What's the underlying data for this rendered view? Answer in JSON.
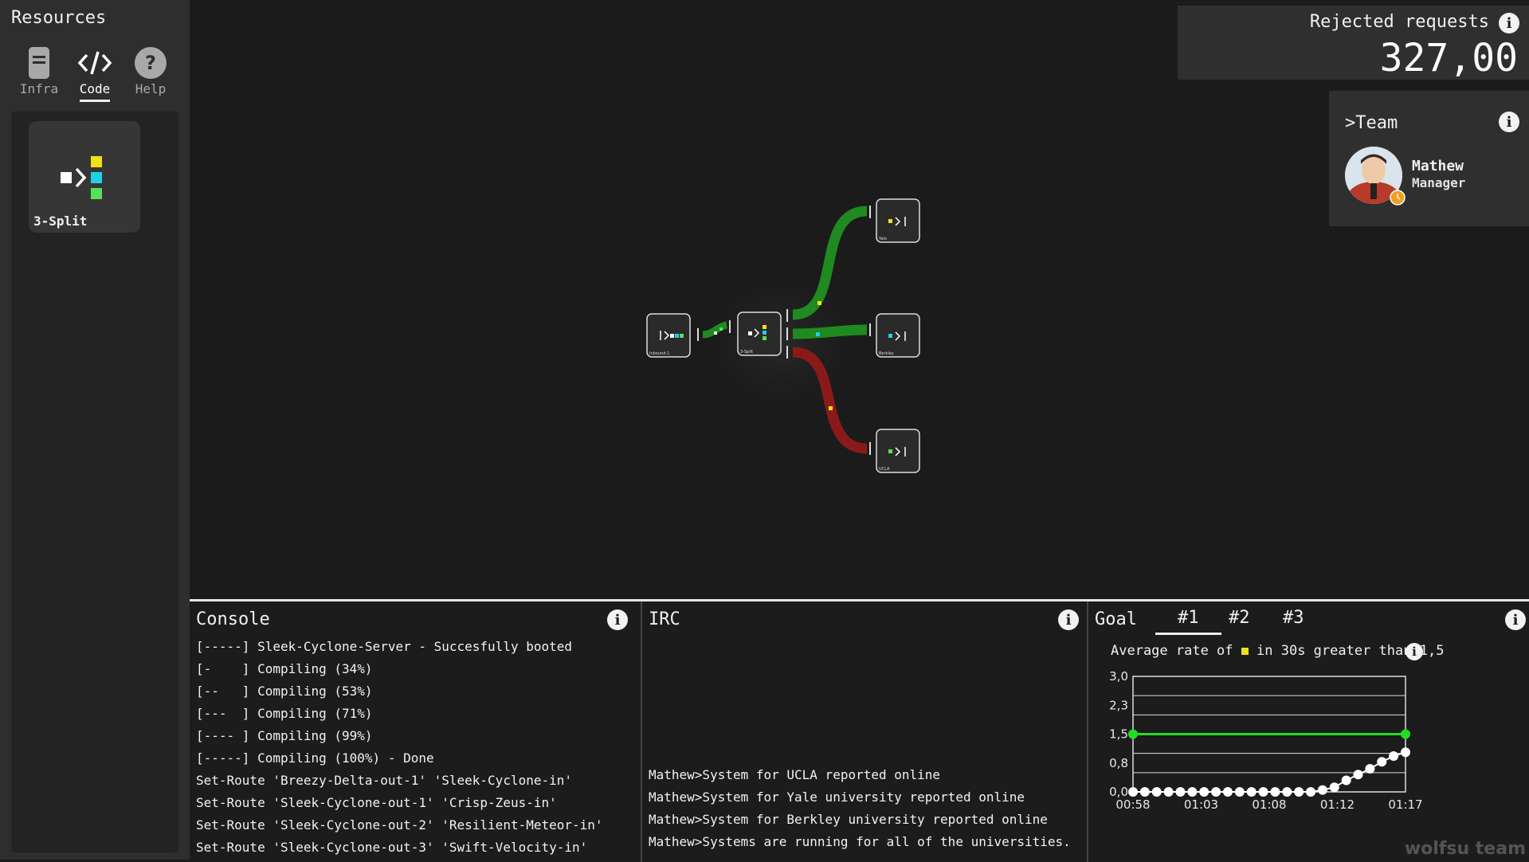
{
  "sidebar": {
    "title": "Resources",
    "tabs": [
      {
        "label": "Infra",
        "icon": "server-icon",
        "active": false
      },
      {
        "label": "Code",
        "icon": "code-icon",
        "active": true
      },
      {
        "label": "Help",
        "icon": "help-icon",
        "active": false
      }
    ],
    "resource_card": {
      "label": "3-Split",
      "icon": "split-icon"
    }
  },
  "rejected": {
    "label": "Rejected requests",
    "value": "327,00"
  },
  "team": {
    "title": "Team",
    "member": {
      "name": "Mathew",
      "role": "Manager"
    }
  },
  "network": {
    "nodes": [
      {
        "id": "inbound",
        "label": "Inbound-1"
      },
      {
        "id": "split",
        "label": "3-Split"
      },
      {
        "id": "yale",
        "label": "Yale"
      },
      {
        "id": "berkley",
        "label": "Berkley"
      },
      {
        "id": "ucla",
        "label": "UCLA"
      }
    ],
    "colors": {
      "ok": "#1f8a1f",
      "bad": "#8a1a1a",
      "yellow": "#f0e21a",
      "cyan": "#22d0e6",
      "green": "#58e058"
    }
  },
  "console": {
    "title": "Console",
    "lines": [
      "[-----] Sleek-Cyclone-Server - Succesfully booted",
      "[-    ] Compiling (34%)",
      "[--   ] Compiling (53%)",
      "[---  ] Compiling (71%)",
      "[---- ] Compiling (99%)",
      "[-----] Compiling (100%) - Done",
      "Set-Route 'Breezy-Delta-out-1' 'Sleek-Cyclone-in'",
      "Set-Route 'Sleek-Cyclone-out-1' 'Crisp-Zeus-in'",
      "Set-Route 'Sleek-Cyclone-out-2' 'Resilient-Meteor-in'",
      "Set-Route 'Sleek-Cyclone-out-3' 'Swift-Velocity-in'"
    ]
  },
  "irc": {
    "title": "IRC",
    "lines": [
      "Mathew>System for UCLA reported online",
      "Mathew>System for Yale university reported online",
      "Mathew>System for Berkley university reported online",
      "Mathew>Systems are running for all of the universities."
    ]
  },
  "goal": {
    "title": "Goal",
    "tabs": [
      "#1",
      "#2",
      "#3"
    ],
    "description_prefix": "Average rate of",
    "description_suffix": "in 30s greater than 1,5",
    "square_color": "#f0e21a"
  },
  "chart_data": {
    "type": "line",
    "x_ticks": [
      "00:58",
      "01:03",
      "01:08",
      "01:12",
      "01:17"
    ],
    "y_ticks": [
      "0,0",
      "0,8",
      "1,5",
      "2,3",
      "3,0"
    ],
    "ylim": [
      0,
      3
    ],
    "threshold": {
      "value": 1.5,
      "color": "#22dd22"
    },
    "series": [
      {
        "values": [
          0,
          0,
          0,
          0,
          0,
          0,
          0,
          0,
          0,
          0,
          0,
          0,
          0,
          0,
          0,
          0,
          0.05,
          0.12,
          0.3,
          0.45,
          0.6,
          0.78,
          0.93,
          1.03
        ],
        "color": "#ffffff"
      }
    ]
  },
  "watermark": "wolfsu team"
}
